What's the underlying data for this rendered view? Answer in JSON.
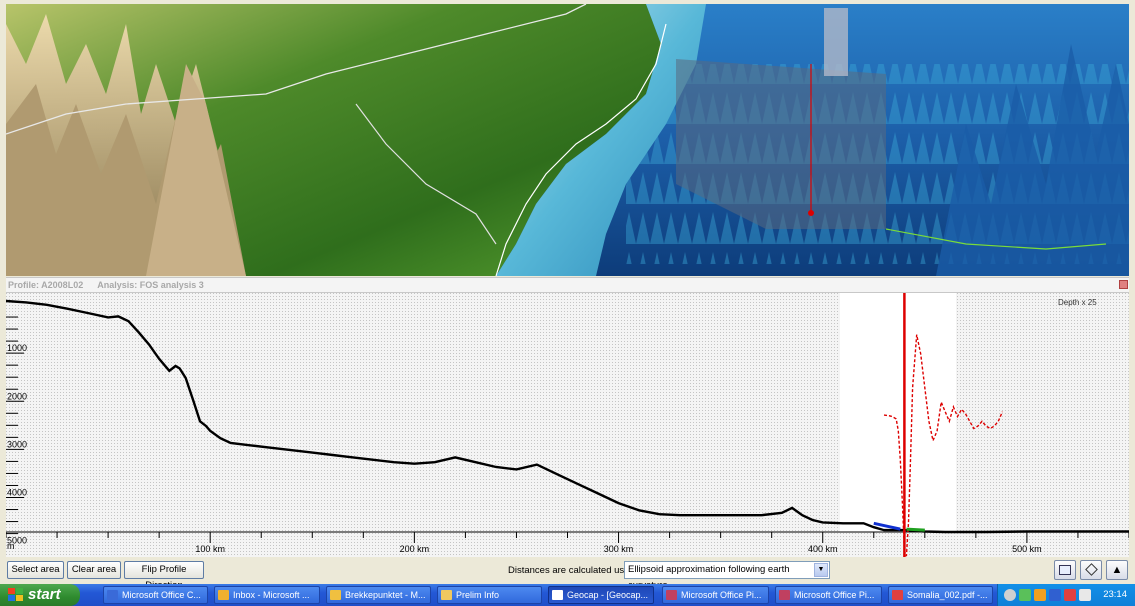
{
  "profile_header": {
    "profile": "Profile: A2008L02",
    "analysis": "Analysis: FOS analysis 3"
  },
  "chart_data": {
    "type": "line",
    "ylabel": "m",
    "xlabel": "",
    "y_ticks": [
      "1000",
      "2000",
      "3000",
      "4000",
      "5000"
    ],
    "x_ticks": [
      "100 km",
      "200 km",
      "300 km",
      "400 km",
      "500 km"
    ],
    "ylim": [
      0,
      5000
    ],
    "xlim": [
      0,
      550
    ],
    "y_reversed": true,
    "depth_label": "Depth x 25",
    "series": [
      {
        "color": "#000000",
        "x": [
          0,
          10,
          20,
          30,
          40,
          50,
          55,
          60,
          65,
          70,
          75,
          80,
          83,
          85,
          88,
          92,
          95,
          98,
          100,
          105,
          110,
          120,
          130,
          140,
          150,
          160,
          170,
          180,
          190,
          200,
          210,
          220,
          230,
          240,
          250,
          260,
          270,
          280,
          290,
          300,
          310,
          320,
          330,
          340,
          350,
          360,
          370,
          380,
          385,
          390,
          395,
          400,
          410,
          420,
          425,
          430,
          440,
          450,
          460,
          480,
          500,
          520,
          540,
          550
        ],
        "y": [
          0,
          30,
          80,
          160,
          250,
          340,
          320,
          420,
          650,
          900,
          1200,
          1450,
          1350,
          1400,
          1600,
          2100,
          2500,
          2600,
          2700,
          2850,
          2950,
          3000,
          3050,
          3100,
          3150,
          3200,
          3250,
          3300,
          3350,
          3380,
          3350,
          3250,
          3350,
          3450,
          3500,
          3400,
          3600,
          3800,
          4000,
          4200,
          4350,
          4430,
          4450,
          4450,
          4450,
          4450,
          4450,
          4400,
          4300,
          4450,
          4550,
          4600,
          4620,
          4620,
          4700,
          4760,
          4760,
          4790,
          4800,
          4800,
          4790,
          4790,
          4790,
          4790
        ]
      },
      {
        "color": "#dd0000",
        "x": [
          430,
          432,
          434,
          436,
          437,
          438,
          439,
          440,
          441,
          442,
          443,
          444,
          446,
          448,
          450,
          452,
          454,
          456,
          458,
          460,
          462,
          464,
          466,
          468,
          470,
          472,
          474,
          476,
          478,
          480,
          482,
          484,
          486,
          488
        ],
        "y": [
          2370,
          2380,
          2400,
          2450,
          2700,
          3300,
          4200,
          5200,
          5300,
          4600,
          3300,
          1800,
          700,
          1100,
          1800,
          2500,
          2900,
          2700,
          2100,
          2300,
          2500,
          2200,
          2400,
          2250,
          2350,
          2500,
          2650,
          2600,
          2500,
          2600,
          2650,
          2600,
          2500,
          2300
        ]
      }
    ]
  },
  "toolbar": {
    "select_area": "Select area",
    "clear_area": "Clear area",
    "flip_profile": "Flip Profile Direction",
    "distances_label": "Distances are calculated using",
    "ellipsoid_value": "Ellipsoid approximation following earth curvature"
  },
  "taskbar": {
    "start": "start",
    "tasks": [
      {
        "label": "Microsoft Office C...",
        "color": "#3a6ad8"
      },
      {
        "label": "Inbox - Microsoft ...",
        "color": "#f0b030"
      },
      {
        "label": "Brekkepunktet - M...",
        "color": "#f0c040"
      },
      {
        "label": "Prelim Info",
        "color": "#f0c860"
      },
      {
        "label": "Geocap - [Geocap...",
        "color": "#ffffff"
      },
      {
        "label": "Microsoft Office Pi...",
        "color": "#c04060"
      },
      {
        "label": "Microsoft Office Pi...",
        "color": "#c04060"
      },
      {
        "label": "Somalia_002.pdf -...",
        "color": "#e04040"
      }
    ],
    "clock": "23:14"
  }
}
